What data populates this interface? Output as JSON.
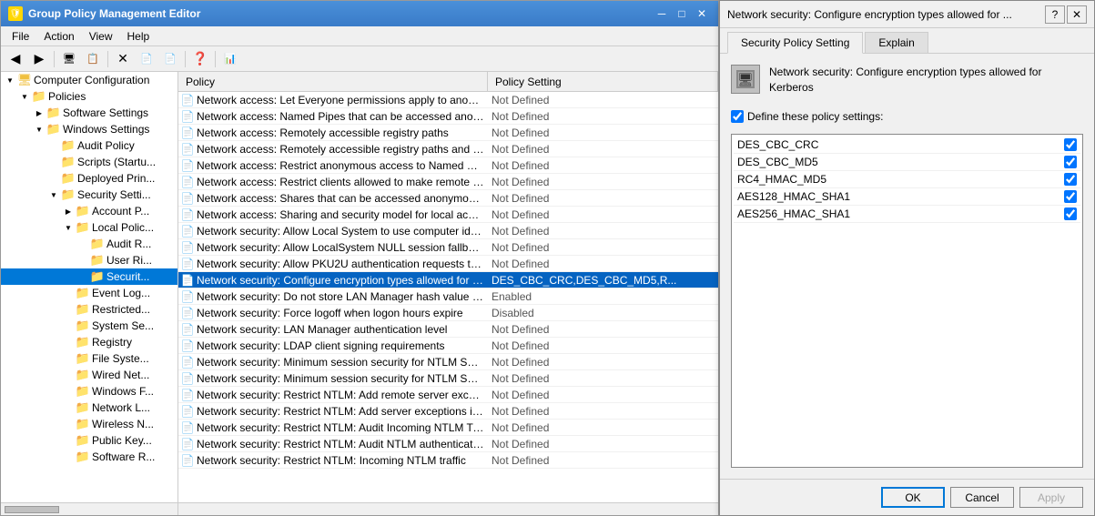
{
  "mainWindow": {
    "title": "Group Policy Management Editor",
    "menuItems": [
      "File",
      "Action",
      "View",
      "Help"
    ],
    "toolbar": {
      "buttons": [
        "◀",
        "▶",
        "⬆",
        "📋",
        "✕",
        "📄",
        "📄",
        "❓",
        "🖥"
      ]
    }
  },
  "treePanel": {
    "items": [
      {
        "id": "computer-config",
        "label": "Computer Configuration",
        "indent": 0,
        "expanded": true,
        "hasExpander": true
      },
      {
        "id": "policies",
        "label": "Policies",
        "indent": 1,
        "expanded": true,
        "hasExpander": true
      },
      {
        "id": "software-settings",
        "label": "Software Settings",
        "indent": 2,
        "expanded": false,
        "hasExpander": true
      },
      {
        "id": "windows-settings",
        "label": "Windows Settings",
        "indent": 2,
        "expanded": true,
        "hasExpander": true
      },
      {
        "id": "audit-policy",
        "label": "Audit Policy",
        "indent": 3,
        "expanded": false,
        "hasExpander": false,
        "selected": false
      },
      {
        "id": "scripts",
        "label": "Scripts (Startu...",
        "indent": 3,
        "expanded": false,
        "hasExpander": false
      },
      {
        "id": "deployed-printers",
        "label": "Deployed Prin...",
        "indent": 3,
        "expanded": false,
        "hasExpander": false
      },
      {
        "id": "security-settings",
        "label": "Security Setti...",
        "indent": 3,
        "expanded": true,
        "hasExpander": true
      },
      {
        "id": "account-policy",
        "label": "Account P...",
        "indent": 4,
        "expanded": false,
        "hasExpander": true
      },
      {
        "id": "local-policy",
        "label": "Local Polic...",
        "indent": 4,
        "expanded": true,
        "hasExpander": true
      },
      {
        "id": "audit-r",
        "label": "Audit R...",
        "indent": 5,
        "expanded": false,
        "hasExpander": false
      },
      {
        "id": "user-r",
        "label": "User Ri...",
        "indent": 5,
        "expanded": false,
        "hasExpander": false
      },
      {
        "id": "security",
        "label": "Securit...",
        "indent": 5,
        "expanded": false,
        "hasExpander": false,
        "selected": true
      },
      {
        "id": "event-log",
        "label": "Event Log...",
        "indent": 4,
        "expanded": false,
        "hasExpander": false
      },
      {
        "id": "restricted",
        "label": "Restricted...",
        "indent": 4,
        "expanded": false,
        "hasExpander": false
      },
      {
        "id": "system-se",
        "label": "System Se...",
        "indent": 4,
        "expanded": false,
        "hasExpander": false
      },
      {
        "id": "registry",
        "label": "Registry",
        "indent": 4,
        "expanded": false,
        "hasExpander": false
      },
      {
        "id": "file-system",
        "label": "File Syste...",
        "indent": 4,
        "expanded": false,
        "hasExpander": false
      },
      {
        "id": "wired-net",
        "label": "Wired Net...",
        "indent": 4,
        "expanded": false,
        "hasExpander": false
      },
      {
        "id": "windows-firewall",
        "label": "Windows F...",
        "indent": 4,
        "expanded": false,
        "hasExpander": false
      },
      {
        "id": "network-list",
        "label": "Network L...",
        "indent": 4,
        "expanded": false,
        "hasExpander": false
      },
      {
        "id": "wireless-n",
        "label": "Wireless N...",
        "indent": 4,
        "expanded": false,
        "hasExpander": false
      },
      {
        "id": "public-key",
        "label": "Public Key...",
        "indent": 4,
        "expanded": false,
        "hasExpander": false
      },
      {
        "id": "software-r",
        "label": "Software R...",
        "indent": 4,
        "expanded": false,
        "hasExpander": false
      }
    ]
  },
  "listPanel": {
    "columns": [
      "Policy",
      "Policy Setting"
    ],
    "rows": [
      {
        "policy": "Network access: Let Everyone permissions apply to anonym...",
        "setting": "Not Defined",
        "selected": false
      },
      {
        "policy": "Network access: Named Pipes that can be accessed anonym...",
        "setting": "Not Defined",
        "selected": false
      },
      {
        "policy": "Network access: Remotely accessible registry paths",
        "setting": "Not Defined",
        "selected": false
      },
      {
        "policy": "Network access: Remotely accessible registry paths and sub...",
        "setting": "Not Defined",
        "selected": false
      },
      {
        "policy": "Network access: Restrict anonymous access to Named Pipes...",
        "setting": "Not Defined",
        "selected": false
      },
      {
        "policy": "Network access: Restrict clients allowed to make remote call...",
        "setting": "Not Defined",
        "selected": false
      },
      {
        "policy": "Network access: Shares that can be accessed anonymously",
        "setting": "Not Defined",
        "selected": false
      },
      {
        "policy": "Network access: Sharing and security model for local accou...",
        "setting": "Not Defined",
        "selected": false
      },
      {
        "policy": "Network security: Allow Local System to use computer ident...",
        "setting": "Not Defined",
        "selected": false
      },
      {
        "policy": "Network security: Allow LocalSystem NULL session fallback",
        "setting": "Not Defined",
        "selected": false
      },
      {
        "policy": "Network security: Allow PKU2U authentication requests to t...",
        "setting": "Not Defined",
        "selected": false
      },
      {
        "policy": "Network security: Configure encryption types allowed for Ke...",
        "setting": "DES_CBC_CRC,DES_CBC_MD5,R...",
        "selected": true
      },
      {
        "policy": "Network security: Do not store LAN Manager hash value on ...",
        "setting": "Enabled",
        "selected": false
      },
      {
        "policy": "Network security: Force logoff when logon hours expire",
        "setting": "Disabled",
        "selected": false
      },
      {
        "policy": "Network security: LAN Manager authentication level",
        "setting": "Not Defined",
        "selected": false
      },
      {
        "policy": "Network security: LDAP client signing requirements",
        "setting": "Not Defined",
        "selected": false
      },
      {
        "policy": "Network security: Minimum session security for NTLM SSP ...",
        "setting": "Not Defined",
        "selected": false
      },
      {
        "policy": "Network security: Minimum session security for NTLM SSP ...",
        "setting": "Not Defined",
        "selected": false
      },
      {
        "policy": "Network security: Restrict NTLM: Add remote server excepti...",
        "setting": "Not Defined",
        "selected": false
      },
      {
        "policy": "Network security: Restrict NTLM: Add server exceptions in t...",
        "setting": "Not Defined",
        "selected": false
      },
      {
        "policy": "Network security: Restrict NTLM: Audit Incoming NTLM Tra...",
        "setting": "Not Defined",
        "selected": false
      },
      {
        "policy": "Network security: Restrict NTLM: Audit NTLM authenticatio...",
        "setting": "Not Defined",
        "selected": false
      },
      {
        "policy": "Network security: Restrict NTLM: Incoming NTLM traffic",
        "setting": "Not Defined",
        "selected": false
      }
    ]
  },
  "dialog": {
    "title": "Network security: Configure encryption types allowed for ...",
    "helpBtn": "?",
    "closeBtn": "✕",
    "tabs": [
      "Security Policy Setting",
      "Explain"
    ],
    "activeTab": "Security Policy Setting",
    "policyTitle": "Network security: Configure encryption types allowed for Kerberos",
    "defineCheckbox": {
      "label": "Define these policy settings:",
      "checked": true
    },
    "encryptionTypes": [
      {
        "label": "DES_CBC_CRC",
        "checked": true
      },
      {
        "label": "DES_CBC_MD5",
        "checked": true
      },
      {
        "label": "RC4_HMAC_MD5",
        "checked": true
      },
      {
        "label": "AES128_HMAC_SHA1",
        "checked": true
      },
      {
        "label": "AES256_HMAC_SHA1",
        "checked": true
      }
    ],
    "buttons": {
      "ok": "OK",
      "cancel": "Cancel",
      "apply": "Apply"
    }
  }
}
